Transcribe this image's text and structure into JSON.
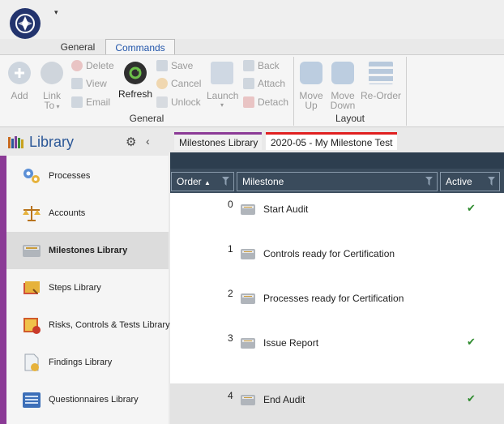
{
  "ribbon": {
    "tabs": [
      "General",
      "Commands"
    ],
    "active_tab": "Commands",
    "general_group": {
      "label": "General",
      "add": "Add",
      "link_to_line1": "Link",
      "link_to_line2": "To",
      "delete": "Delete",
      "view": "View",
      "email": "Email",
      "refresh": "Refresh",
      "save": "Save",
      "cancel": "Cancel",
      "unlock": "Unlock",
      "launch": "Launch",
      "back": "Back",
      "attach": "Attach",
      "detach": "Detach"
    },
    "layout_group": {
      "label": "Layout",
      "move_up_line1": "Move",
      "move_up_line2": "Up",
      "move_down_line1": "Move",
      "move_down_line2": "Down",
      "reorder": "Re-Order"
    }
  },
  "library": {
    "title": "Library",
    "items": [
      {
        "label": "Processes",
        "active": false
      },
      {
        "label": "Accounts",
        "active": false
      },
      {
        "label": "Milestones Library",
        "active": true
      },
      {
        "label": "Steps Library",
        "active": false
      },
      {
        "label": "Risks, Controls & Tests Library",
        "active": false
      },
      {
        "label": "Findings Library",
        "active": false
      },
      {
        "label": "Questionnaires Library",
        "active": false
      }
    ]
  },
  "doc_tabs": [
    "Milestones Library",
    "2020-05 - My Milestone Test"
  ],
  "grid": {
    "columns": [
      "Order",
      "Milestone",
      "Active"
    ],
    "sort_indicator": "▲",
    "rows": [
      {
        "order": "0",
        "milestone": "Start Audit",
        "active": "✔"
      },
      {
        "order": "1",
        "milestone": "Controls ready for Certification",
        "active": ""
      },
      {
        "order": "2",
        "milestone": "Processes ready for Certification",
        "active": ""
      },
      {
        "order": "3",
        "milestone": "Issue Report",
        "active": "✔"
      },
      {
        "order": "4",
        "milestone": "End Audit",
        "active": "✔"
      }
    ]
  },
  "colors": {
    "library_accent": "#8b3a96",
    "test_tab_accent": "#e02020",
    "grid_header": "#3a4b5c",
    "check": "#2e8b2e"
  }
}
